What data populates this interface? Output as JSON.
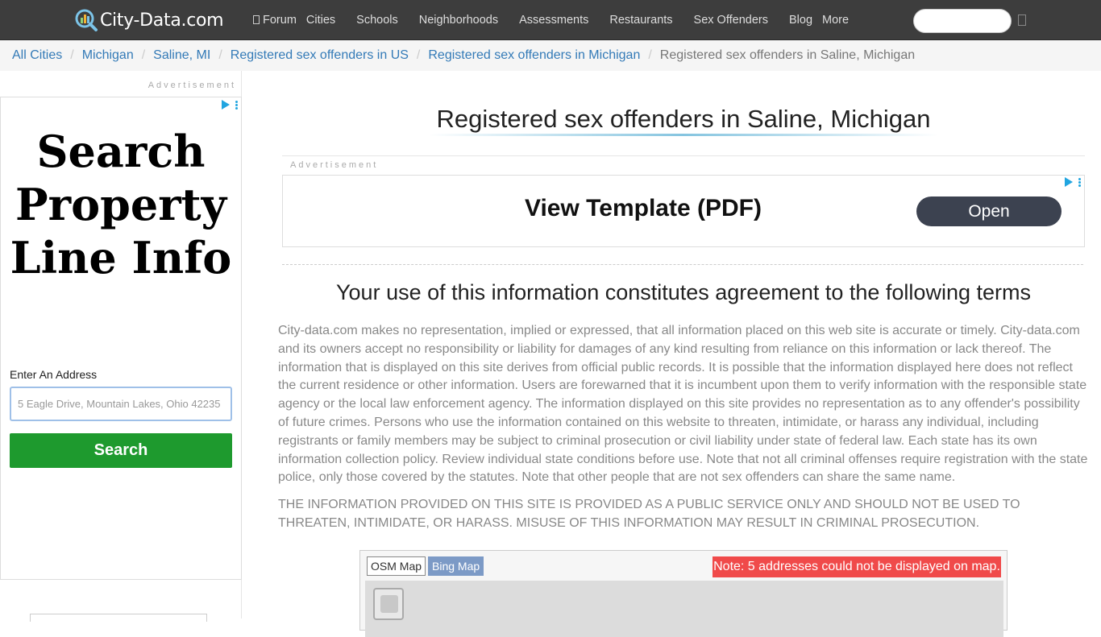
{
  "brand": {
    "name": "City-Data.com"
  },
  "nav": {
    "items": [
      "Forum",
      "Cities",
      "Schools",
      "Neighborhoods",
      "Assessments",
      "Restaurants",
      "Sex Offenders",
      "Blog",
      "More"
    ]
  },
  "breadcrumb": {
    "items": [
      "All Cities",
      "Michigan",
      "Saline, MI",
      "Registered sex offenders in US",
      "Registered sex offenders in Michigan"
    ],
    "current": "Registered sex offenders in Saline, Michigan"
  },
  "left_ad": {
    "label": "Advertisement",
    "headline": [
      "Search",
      "Property",
      "Line Info"
    ],
    "address_label": "Enter An Address",
    "address_placeholder": "5 Eagle Drive, Mountain Lakes, Ohio 42235",
    "search_label": "Search"
  },
  "main": {
    "title": "Registered sex offenders in Saline, Michigan",
    "top_ad": {
      "label": "Advertisement",
      "text": "View Template (PDF)",
      "button": "Open"
    },
    "terms_heading": "Your use of this information constitutes agreement to the following terms",
    "terms_body": "City-data.com makes no representation, implied or expressed, that all information placed on this web site is accurate or timely. City-data.com and its owners accept no responsibility or liability for damages of any kind resulting from reliance on this information or lack thereof. The information that is displayed on this site derives from official public records. It is possible that the information displayed here does not reflect the current residence or other information. Users are forewarned that it is incumbent upon them to verify information with the responsible state agency or the local law enforcement agency. The information displayed on this site provides no representation as to any offender's possibility of future crimes. Persons who use the information contained on this website to threaten, intimidate, or harass any individual, including registrants or family members may be subject to criminal prosecution or civil liability under state of federal law. Each state has its own information collection policy. Review individual state conditions before use. Note that not all criminal offenses require registration with the state police, only those covered by the statutes. Note that other people that are not sex offenders can share the same name.",
    "terms_caps": "THE INFORMATION PROVIDED ON THIS SITE IS PROVIDED AS A PUBLIC SERVICE ONLY AND SHOULD NOT BE USED TO THREATEN, INTIMIDATE, OR HARASS. MISUSE OF THIS INFORMATION MAY RESULT IN CRIMINAL PROSECUTION.",
    "map": {
      "tabs": [
        "OSM Map",
        "Bing Map"
      ],
      "note": "Note: 5 addresses could not be displayed on map."
    }
  },
  "colors": {
    "navbar": "#3d3d3d",
    "link": "#337ab7",
    "search_button": "#1e9a2e",
    "open_button": "#3c4250",
    "map_note": "#f04a4a"
  },
  "icons": [
    "city-data-logo-icon",
    "forum-icon",
    "search-icon",
    "ad-choices-icon",
    "ad-menu-icon",
    "map-zoom-icon"
  ]
}
